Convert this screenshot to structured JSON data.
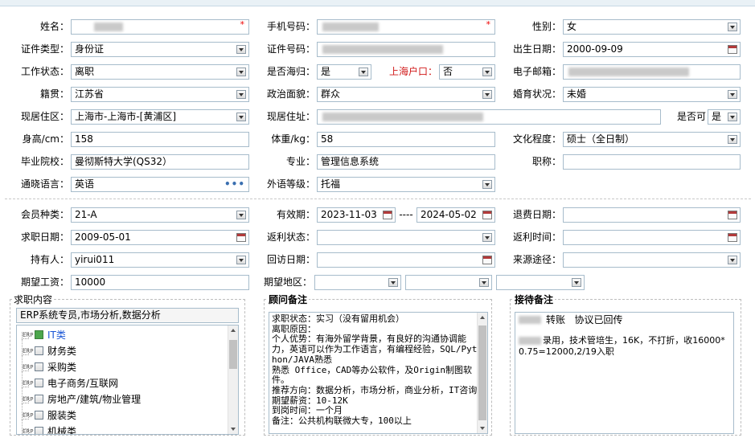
{
  "form": {
    "name": {
      "label": "姓名："
    },
    "phone": {
      "label": "手机号码："
    },
    "gender": {
      "label": "性别：",
      "value": "女"
    },
    "id_type": {
      "label": "证件类型：",
      "value": "身份证"
    },
    "id_number": {
      "label": "证件号码："
    },
    "birth_date": {
      "label": "出生日期：",
      "value": "2000-09-09"
    },
    "work_status": {
      "label": "工作状态：",
      "value": "离职"
    },
    "overseas_return": {
      "label": "是否海归：",
      "value": "是"
    },
    "shanghai_hukou": {
      "label": "上海户口：",
      "value": "否"
    },
    "email": {
      "label": "电子邮箱："
    },
    "native_place": {
      "label": "籍贯：",
      "value": "江苏省"
    },
    "political_status": {
      "label": "政治面貌：",
      "value": "群众"
    },
    "marital_status": {
      "label": "婚育状况：",
      "value": "未婚"
    },
    "current_district": {
      "label": "现居住区：",
      "value": "上海市-上海市-[黄浦区]"
    },
    "current_address": {
      "label": "现居住址："
    },
    "is_available": {
      "label": "是否可",
      "value": "是"
    },
    "height": {
      "label": "身高/cm：",
      "value": "158"
    },
    "weight": {
      "label": "体重/kg：",
      "value": "58"
    },
    "education": {
      "label": "文化程度：",
      "value": "硕士（全日制）"
    },
    "university": {
      "label": "毕业院校：",
      "value": "曼彻斯特大学(QS32）"
    },
    "major": {
      "label": "专业：",
      "value": "管理信息系统"
    },
    "job_title": {
      "label": "职称：",
      "value": ""
    },
    "language": {
      "label": "通晓语言：",
      "value": "英语"
    },
    "language_level": {
      "label": "外语等级：",
      "value": "托福"
    }
  },
  "membership": {
    "member_type": {
      "label": "会员种类：",
      "value": "21-A"
    },
    "validity": {
      "label": "有效期：",
      "start": "2023-11-03",
      "separator": "----",
      "end": "2024-05-02"
    },
    "refund_date": {
      "label": "退费日期：",
      "value": ""
    },
    "job_seek_date": {
      "label": "求职日期：",
      "value": "2009-05-01"
    },
    "rebate_status": {
      "label": "返利状态：",
      "value": ""
    },
    "rebate_time": {
      "label": "返利时间：",
      "value": ""
    },
    "holder": {
      "label": "持有人：",
      "value": "yirui011"
    },
    "followup_date": {
      "label": "回访日期：",
      "value": ""
    },
    "source": {
      "label": "来源途径：",
      "value": ""
    },
    "expected_salary": {
      "label": "期望工资：",
      "value": "10000"
    },
    "expected_region": {
      "label": "期望地区：",
      "values": [
        "",
        "",
        ""
      ]
    }
  },
  "job_content": {
    "title": "求职内容",
    "value": "ERP系统专员,市场分析,数据分析",
    "tree": [
      {
        "label": "IT类",
        "checked": true
      },
      {
        "label": "财务类",
        "checked": false
      },
      {
        "label": "采购类",
        "checked": false
      },
      {
        "label": "电子商务/互联网",
        "checked": false
      },
      {
        "label": "房地产/建筑/物业管理",
        "checked": false
      },
      {
        "label": "服装类",
        "checked": false
      },
      {
        "label": "机械类",
        "checked": false
      }
    ],
    "expander_text": "ERP"
  },
  "consultant_notes": {
    "title": "顾问备注",
    "text": "求职状态：实习（没有留用机会）\n离职原因：\n个人优势：有海外留学背景，有良好的沟通协调能力，英语可以作为工作语言，有编程经验，SQL/Python/JAVA熟悉\n熟悉 Office，CAD等办公软件，及Origin制图软件。\n推荐方向：数据分析，市场分析，商业分析，IT咨询\n期望薪资：10-12K\n到岗时间：一个月\n备注：公共机构联微大专，100以上"
  },
  "reception_notes": {
    "title": "接待备注",
    "line1": "转账   协议已回传",
    "line2": "录用，技术管培生，16K，不打折，收16000*0.75=12000,2/19入职"
  },
  "colors": {
    "border": "#a7bccb",
    "required": "#e00000",
    "label_red": "#d01818",
    "check_on": "#4ca64c"
  }
}
